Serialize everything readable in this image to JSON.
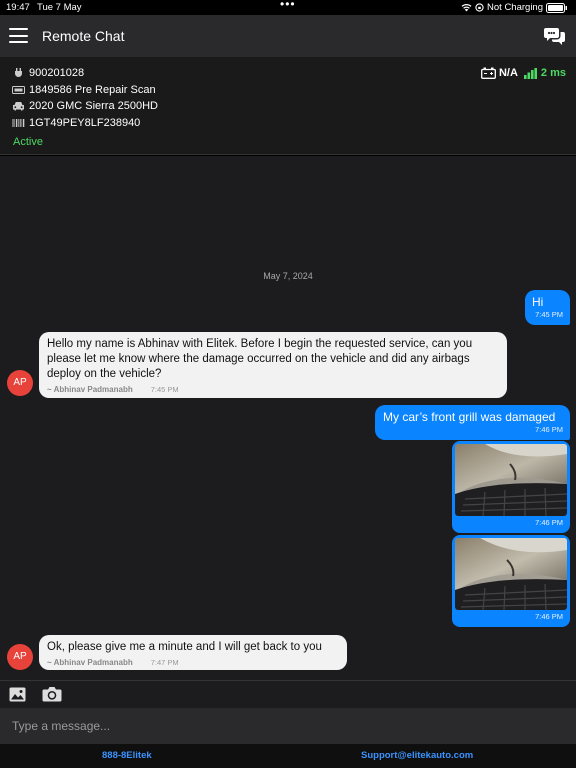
{
  "status_bar": {
    "time": "19:47",
    "date": "Tue 7 May",
    "charging": "Not Charging"
  },
  "header": {
    "title": "Remote Chat"
  },
  "info": {
    "device_id": "900201028",
    "scan": "1849586 Pre Repair Scan",
    "vehicle": "2020 GMC Sierra 2500HD",
    "vin": "1GT49PEY8LF238940",
    "status": "Active",
    "battery": "N/A",
    "latency": "2 ms"
  },
  "chat": {
    "date": "May 7, 2024",
    "messages": [
      {
        "text": "Hi",
        "time": "7:45 PM"
      },
      {
        "text": "Hello my name is Abhinav with Elitek. Before I begin the requested service, can you please let me know where the damage occurred on the vehicle and did any airbags deploy on the vehicle?",
        "sender": "~ Abhinav Padmanabh",
        "time": "7:45 PM",
        "initials": "AP"
      },
      {
        "text": "My car’s front grill was damaged",
        "time": "7:46 PM"
      },
      {
        "time": "7:46 PM"
      },
      {
        "time": "7:46 PM"
      },
      {
        "text": "Ok, please give me a minute and I will get back to you",
        "sender": "~ Abhinav Padmanabh",
        "time": "7:47 PM",
        "initials": "AP"
      }
    ]
  },
  "composer": {
    "placeholder": "Type a message..."
  },
  "footer": {
    "phone": "888-8Elitek",
    "email": "Support@elitekauto.com"
  },
  "colors": {
    "accent": "#0a84ff",
    "active": "#4cd964",
    "avatar": "#e8433a"
  }
}
